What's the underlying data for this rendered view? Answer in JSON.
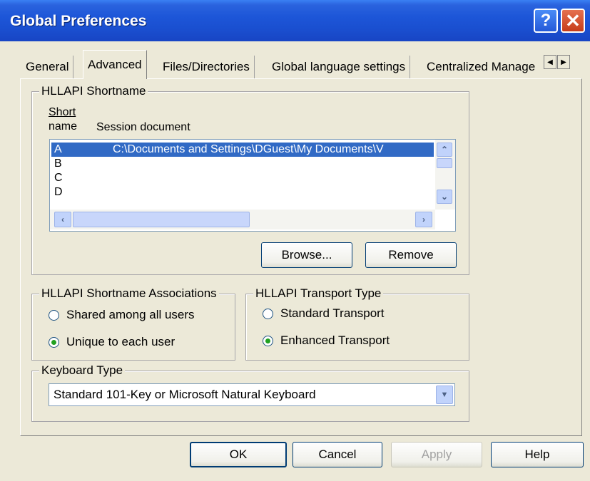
{
  "window": {
    "title": "Global Preferences",
    "help_glyph": "?",
    "close_glyph": "✕"
  },
  "tabs": [
    {
      "label": "General"
    },
    {
      "label": "Advanced"
    },
    {
      "label": "Files/Directories"
    },
    {
      "label": "Global language settings"
    },
    {
      "label": "Centralized Manage"
    }
  ],
  "tab_scroll": {
    "left": "◀",
    "right": "▶"
  },
  "shortname_group": {
    "label": "HLLAPI Shortname",
    "col_short": "Short name",
    "col_short_line1": "Short",
    "col_short_line2": "name",
    "col_doc": "Session document",
    "rows": [
      {
        "short": "A",
        "doc": "C:\\Documents and Settings\\DGuest\\My Documents\\V"
      },
      {
        "short": "B",
        "doc": ""
      },
      {
        "short": "C",
        "doc": ""
      },
      {
        "short": "D",
        "doc": ""
      }
    ],
    "browse_label": "Browse...",
    "remove_label": "Remove"
  },
  "associations_group": {
    "label": "HLLAPI Shortname Associations",
    "options": [
      {
        "label": "Shared among all users",
        "checked": false
      },
      {
        "label": "Unique to each user",
        "checked": true
      }
    ]
  },
  "transport_group": {
    "label": "HLLAPI Transport Type",
    "options": [
      {
        "label": "Standard Transport",
        "checked": false
      },
      {
        "label": "Enhanced Transport",
        "checked": true
      }
    ]
  },
  "keyboard_group": {
    "label": "Keyboard Type",
    "selected": "Standard 101-Key or Microsoft Natural Keyboard"
  },
  "footer": {
    "ok": "OK",
    "cancel": "Cancel",
    "apply": "Apply",
    "help": "Help"
  },
  "colors": {
    "titlebar": "#1d56d8",
    "selection": "#316ac5",
    "dialog_bg": "#ece9d8"
  }
}
